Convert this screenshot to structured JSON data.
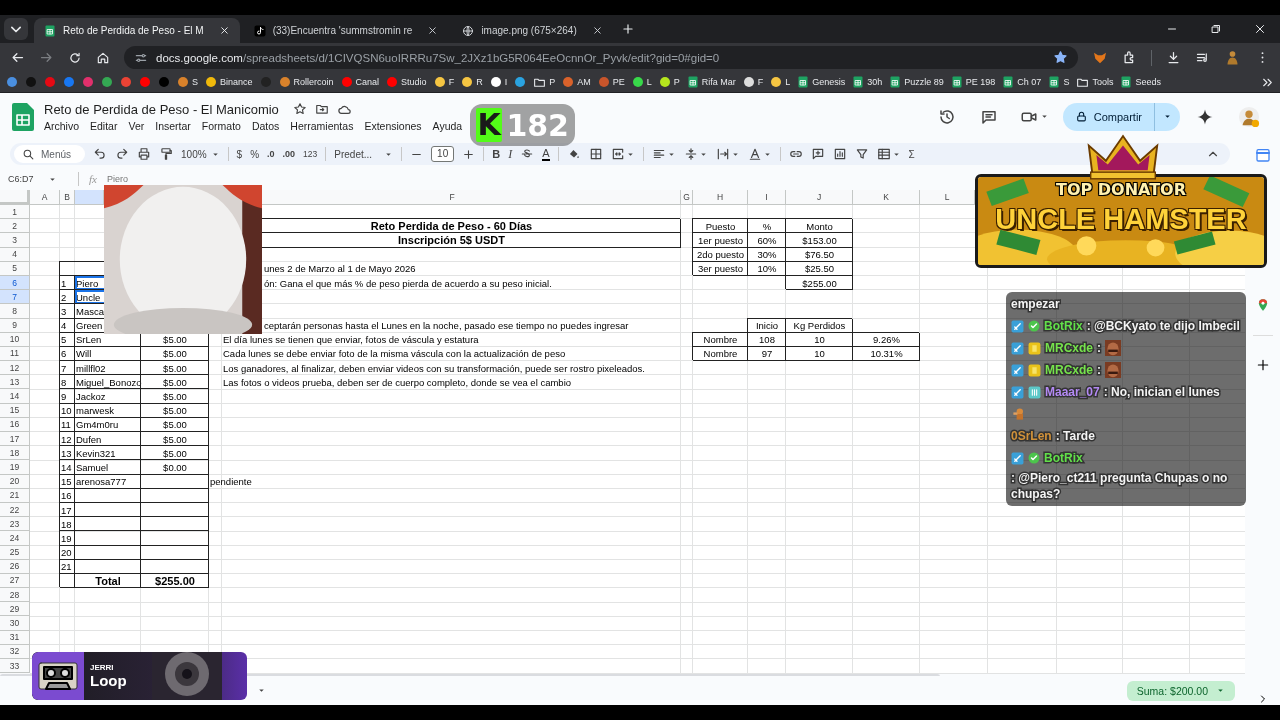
{
  "browser": {
    "tabs": [
      {
        "title": "Reto de Perdida de Peso - El M",
        "kind": "sheets",
        "selected": true
      },
      {
        "title": "(33)Encuentra 'summstromin re",
        "kind": "tiktok",
        "selected": false
      },
      {
        "title": "image.png (675×264)",
        "kind": "globe",
        "selected": false
      }
    ],
    "address": {
      "domain": "docs.google.com",
      "path": "/spreadsheets/d/1CIVQSN6uoIRRRu7Sw_2JXz1bG5R064EeOcnnOr_Pyvk/edit?gid=0#gid=0",
      "bookmarked": true
    },
    "bookmarks": [
      {
        "kind": "dot",
        "color": "#4a8fe0"
      },
      {
        "kind": "dot",
        "color": "#111111"
      },
      {
        "kind": "dot",
        "color": "#e50914"
      },
      {
        "kind": "dot",
        "color": "#1877f2"
      },
      {
        "kind": "dot",
        "color": "#e1306c"
      },
      {
        "kind": "dot",
        "color": "#34a853"
      },
      {
        "kind": "dot",
        "color": "#ea4335"
      },
      {
        "kind": "dot",
        "color": "#ff0000"
      },
      {
        "kind": "dot",
        "color": "#000000"
      },
      {
        "kind": "dot",
        "color": "#d9822b",
        "label": "S"
      },
      {
        "kind": "dot",
        "color": "#f0b90b",
        "label": "Binance"
      },
      {
        "kind": "dot",
        "color": "#222222"
      },
      {
        "kind": "dot",
        "color": "#d9822b",
        "label": "Rollercoin"
      },
      {
        "kind": "dot",
        "color": "#ff0000",
        "label": "Canal"
      },
      {
        "kind": "dot",
        "color": "#ff0000",
        "label": "Studio"
      },
      {
        "kind": "dot",
        "color": "#f5c542",
        "label": "F"
      },
      {
        "kind": "dot",
        "color": "#f5c542",
        "label": "R"
      },
      {
        "kind": "dot",
        "color": "#ffffff",
        "label": "I"
      },
      {
        "kind": "dot",
        "color": "#2aa3e0"
      },
      {
        "kind": "folder",
        "label": "P"
      },
      {
        "kind": "dot",
        "color": "#d9622b",
        "label": "AM"
      },
      {
        "kind": "dot",
        "color": "#c8552b",
        "label": "PE"
      },
      {
        "kind": "dot",
        "color": "#38d94a",
        "label": "L"
      },
      {
        "kind": "dot",
        "color": "#b5e61d",
        "label": "P"
      },
      {
        "kind": "sheets",
        "label": "Rifa Mar"
      },
      {
        "kind": "dot",
        "color": "#dddddd",
        "label": "F"
      },
      {
        "kind": "dot",
        "color": "#f5c542",
        "label": "L"
      },
      {
        "kind": "sheets",
        "label": "Genesis"
      },
      {
        "kind": "sheets",
        "label": "30h"
      },
      {
        "kind": "sheets",
        "label": "Puzzle 89"
      },
      {
        "kind": "sheets",
        "label": "PE 198"
      },
      {
        "kind": "sheets",
        "label": "Ch 07"
      },
      {
        "kind": "sheets",
        "label": "S"
      },
      {
        "kind": "folder",
        "label": "Tools"
      },
      {
        "kind": "sheets",
        "label": "Seeds"
      }
    ]
  },
  "document": {
    "title": "Reto de Perdida de Peso - El Manicomio",
    "menu": [
      "Archivo",
      "Editar",
      "Ver",
      "Insertar",
      "Formato",
      "Datos",
      "Herramientas",
      "Extensiones",
      "Ayuda"
    ],
    "share_label": "Compartir"
  },
  "toolbar": {
    "search": "Menús",
    "zoom": "100%",
    "currency": "$",
    "percent": "%",
    "decimals_less": ".0",
    "decimals_more": ".00",
    "number_format": "123",
    "font": "Predet...",
    "font_size": "10",
    "bold": "B",
    "italic": "I",
    "text_color": "A",
    "functions": "Σ"
  },
  "formula_bar": {
    "range": "C6:D7",
    "fx": "fx",
    "value": "Piero"
  },
  "sheet": {
    "column_headers": [
      {
        "letter": "A",
        "selected": false
      },
      {
        "letter": "B",
        "selected": false
      },
      {
        "selected": true
      },
      {
        "letter": "F",
        "selected": false
      },
      {
        "letter": "G",
        "selected": false
      },
      {
        "letter": "H",
        "selected": false
      },
      {
        "letter": "I",
        "selected": false
      },
      {
        "letter": "J",
        "selected": false
      },
      {
        "letter": "K",
        "selected": false
      },
      {
        "letter": "L",
        "selected": false
      }
    ],
    "row_headers": [
      {
        "number": "1",
        "selected": false
      },
      {
        "number": "2",
        "selected": false
      },
      {
        "number": "3",
        "selected": false
      },
      {
        "number": "4",
        "selected": false
      },
      {
        "number": "5",
        "selected": false
      },
      {
        "number": "6",
        "selected": true
      },
      {
        "number": "7",
        "selected": true
      },
      {
        "number": "8",
        "selected": false
      },
      {
        "number": "9",
        "selected": false
      },
      {
        "number": "10",
        "selected": false
      },
      {
        "number": "11",
        "selected": false
      },
      {
        "number": "12",
        "selected": false
      },
      {
        "number": "13",
        "selected": false
      },
      {
        "number": "14",
        "selected": false
      },
      {
        "number": "15",
        "selected": false
      },
      {
        "number": "16",
        "selected": false
      },
      {
        "number": "17",
        "selected": false
      },
      {
        "number": "18",
        "selected": false
      },
      {
        "number": "19",
        "selected": false
      },
      {
        "number": "20",
        "selected": false
      },
      {
        "number": "21",
        "selected": false
      },
      {
        "number": "22",
        "selected": false
      },
      {
        "number": "23",
        "selected": false
      },
      {
        "number": "24",
        "selected": false
      },
      {
        "number": "25",
        "selected": false
      },
      {
        "number": "26",
        "selected": false
      },
      {
        "number": "27",
        "selected": false
      },
      {
        "number": "28",
        "selected": false
      },
      {
        "number": "29",
        "selected": false
      },
      {
        "number": "30",
        "selected": false
      },
      {
        "number": "31",
        "selected": false
      },
      {
        "number": "32",
        "selected": false
      },
      {
        "number": "33",
        "selected": false
      }
    ],
    "title_box": {
      "title": "Reto Perdida de Peso - 60 Días",
      "subtitle": "Inscripción 5$ USDT"
    },
    "notes": [
      {
        "text": "unes 2 de Marzo al 1 de Mayo 2026",
        "partly_hidden": true
      },
      {
        "text": "ón: Gana el que más % de peso pierda de acuerdo a su peso inicial.",
        "partly_hidden": true
      },
      {
        "text": "ceptarán personas hasta el Lunes en la noche, pasado ese tiempo no puedes ingresar",
        "partly_hidden": true
      },
      {
        "text": "El día lunes se tienen que enviar, fotos de váscula y estatura",
        "partly_hidden": false
      },
      {
        "text": "Cada lunes se debe enviar foto de la misma váscula con la actualización de peso",
        "partly_hidden": false
      },
      {
        "text": "Los ganadores, al finalizar, deben enviar videos con su transformación, puede ser rostro pixeleados.",
        "partly_hidden": false
      },
      {
        "text": "Las fotos o videos prueba, deben ser de cuerpo completo, donde se vea el cambio",
        "partly_hidden": false
      }
    ],
    "participants": {
      "entries": [
        {
          "number": "1",
          "name": "Piero",
          "selected": true
        },
        {
          "number": "2",
          "name": "Uncle",
          "selected": true
        },
        {
          "number": "3",
          "name": "Masca",
          "selected": false
        },
        {
          "number": "4",
          "name": "Green",
          "selected": false
        },
        {
          "number": "5",
          "name": "SrLen",
          "fee": "$5.00",
          "selected": false
        },
        {
          "number": "6",
          "name": "Will",
          "fee": "$5.00",
          "selected": false
        },
        {
          "number": "7",
          "name": "millfl02",
          "fee": "$5.00",
          "selected": false
        },
        {
          "number": "8",
          "name": "Miguel_Bonozo",
          "fee": "$5.00",
          "selected": false
        },
        {
          "number": "9",
          "name": "Jackoz",
          "fee": "$5.00",
          "selected": false
        },
        {
          "number": "10",
          "name": "marwesk",
          "fee": "$5.00",
          "selected": false
        },
        {
          "number": "11",
          "name": "Gm4m0ru",
          "fee": "$5.00",
          "selected": false
        },
        {
          "number": "12",
          "name": "Dufen",
          "fee": "$5.00",
          "selected": false
        },
        {
          "number": "13",
          "name": "Kevin321",
          "fee": "$5.00",
          "selected": false
        },
        {
          "number": "14",
          "name": "Samuel",
          "fee": "$0.00",
          "selected": false
        },
        {
          "number": "15",
          "name": "arenosa777",
          "note": "pendiente",
          "selected": false
        },
        {
          "number": "16",
          "selected": false
        },
        {
          "number": "17",
          "selected": false
        },
        {
          "number": "18",
          "selected": false
        },
        {
          "number": "19",
          "selected": false
        },
        {
          "number": "20",
          "selected": false
        },
        {
          "number": "21",
          "selected": false
        }
      ],
      "total_label": "Total",
      "total": "$255.00"
    },
    "prizes": {
      "columns": [
        "Puesto",
        "%",
        "Monto"
      ],
      "rows": [
        [
          "1er puesto",
          "60%",
          "$153.00"
        ],
        [
          "2do puesto",
          "30%",
          "$76.50"
        ],
        [
          "3er puesto",
          "10%",
          "$25.50"
        ]
      ],
      "total": "$255.00"
    },
    "progress": {
      "columns": [
        "Inicio",
        "Kg Perdidos"
      ],
      "rows": [
        {
          "name": "Nombre",
          "start": "108",
          "lost": "10",
          "percent": "9.26%"
        },
        {
          "name": "Nombre",
          "start": "97",
          "lost": "10",
          "percent": "10.31%"
        }
      ]
    }
  },
  "sheet_bar": {
    "sum": "Suma: $200.00"
  },
  "stream": {
    "follower_badge": {
      "logo": "K",
      "count": "182"
    },
    "banner": {
      "caption": "TOP DONATOR",
      "name": "UNCLE HAMSTER"
    },
    "chat": [
      {
        "kind": "continuation",
        "text": "empezar"
      },
      {
        "kind": "message",
        "badges": [
          {
            "kind": "mod"
          },
          {
            "kind": "verified"
          }
        ],
        "user": "BotRix",
        "color": "#62e04a",
        "text": ": @BCKyato te dijo Imbecil"
      },
      {
        "kind": "message",
        "badges": [
          {
            "kind": "mod"
          },
          {
            "kind": "sub"
          }
        ],
        "user": "MRCxde",
        "color": "#76e34c",
        "text": ":",
        "emote": true
      },
      {
        "kind": "message",
        "badges": [
          {
            "kind": "mod"
          },
          {
            "kind": "sub"
          }
        ],
        "user": "MRCxde",
        "color": "#76e34c",
        "text": ":",
        "emote": true
      },
      {
        "kind": "message",
        "badges": [
          {
            "kind": "mod"
          },
          {
            "kind": "sub_alt"
          }
        ],
        "user": "Maaar_07",
        "color": "#b48af5",
        "text": ": No, inician el lunes",
        "sprite": true
      },
      {
        "kind": "message",
        "user": "0SrLen",
        "color": "#d0913a",
        "text": ": Tarde"
      },
      {
        "kind": "message",
        "badges": [
          {
            "kind": "mod"
          },
          {
            "kind": "verified"
          }
        ],
        "user": "BotRix",
        "color": "#62e04a",
        "text": ": @Piero_ct211 pregunta Chupas o no chupas?"
      }
    ],
    "now_playing": {
      "artist": "JERRI",
      "title": "Loop"
    }
  }
}
